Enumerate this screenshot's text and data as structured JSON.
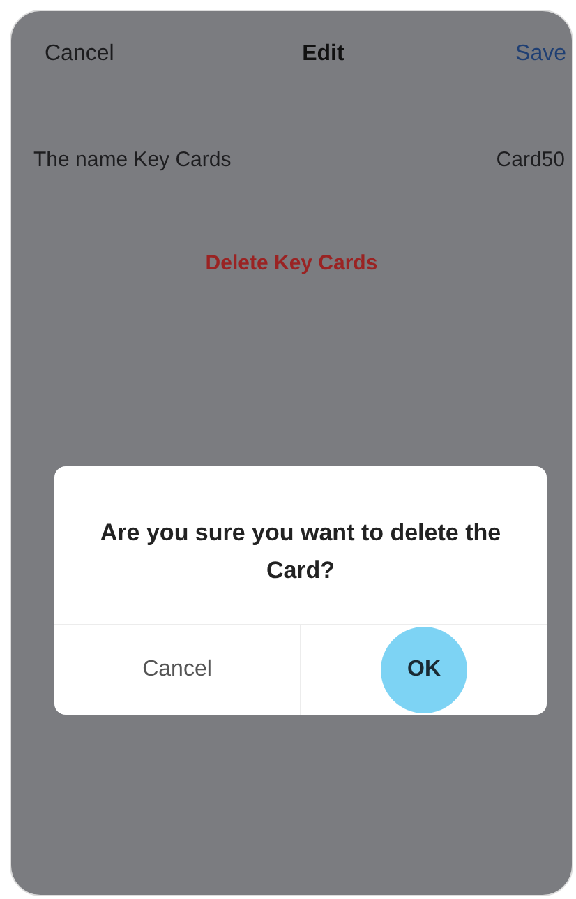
{
  "header": {
    "cancel": "Cancel",
    "title": "Edit",
    "save": "Save"
  },
  "name_row": {
    "label": "The name Key Cards",
    "value": "Card50"
  },
  "delete_button": "Delete Key Cards",
  "dialog": {
    "message": "Are you sure you want to delete the Card?",
    "buttons": [
      {
        "label": "Cancel",
        "kind": "cancel",
        "pressed": false
      },
      {
        "label": "OK",
        "kind": "confirm",
        "pressed": true
      }
    ]
  }
}
